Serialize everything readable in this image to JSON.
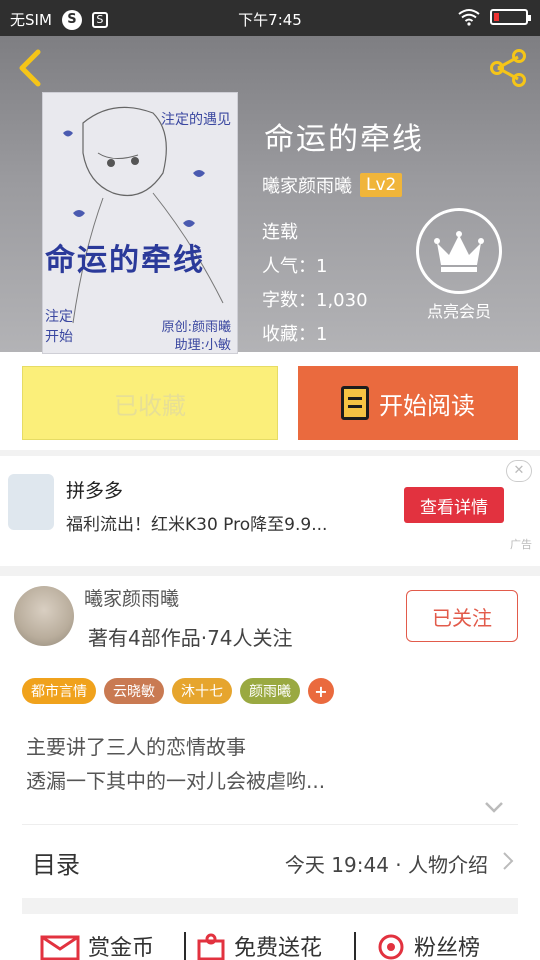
{
  "status_bar": {
    "carrier": "无SIM",
    "time": "下午7:45"
  },
  "book": {
    "title": "命运的牵线",
    "author": "曦家颜雨曦",
    "level": "Lv2",
    "status": "连载",
    "popularity_label": "人气：1",
    "word_count_label": "字数：1,030",
    "collect_label": "收藏：1"
  },
  "cover": {
    "title_text": "命运的牵线",
    "tag_top": "注定的遇见",
    "tag_bottom_1": "注定",
    "tag_bottom_2": "开始",
    "credit_1": "原创:颜雨曦",
    "credit_2": "助理:小敏"
  },
  "vip": {
    "label": "点亮会员"
  },
  "actions": {
    "collected_label": "已收藏",
    "read_label": "开始阅读"
  },
  "ad": {
    "brand": "拼多多",
    "desc": "福利流出！红米K30 Pro降至9.9...",
    "button": "查看详情",
    "close": "✕",
    "tag": "广告"
  },
  "author_section": {
    "name": "曦家颜雨曦",
    "stats": "著有4部作品·74人关注",
    "follow_label": "已关注"
  },
  "tags": [
    {
      "label": "都市言情",
      "color": "#f0a21c"
    },
    {
      "label": "云晓敏",
      "color": "#c97a52"
    },
    {
      "label": "沐十七",
      "color": "#e6a52e"
    },
    {
      "label": "颜雨曦",
      "color": "#9aa941"
    },
    {
      "label": "+",
      "color": "#ea6a3e"
    }
  ],
  "description": {
    "line1": "主要讲了三人的恋情故事",
    "line2": "透漏一下其中的一对儿会被虐哟..."
  },
  "toc": {
    "label": "目录",
    "latest": "今天 19:44 · 人物介绍"
  },
  "bottom_bar": {
    "reward": "赏金币",
    "flower": "免费送花",
    "fans": "粉丝榜"
  },
  "colors": {
    "accent_orange": "#ea6a3e",
    "collect_yellow": "#fbef7a",
    "lv_gold": "#f0b53a",
    "ad_red": "#e2323f"
  }
}
